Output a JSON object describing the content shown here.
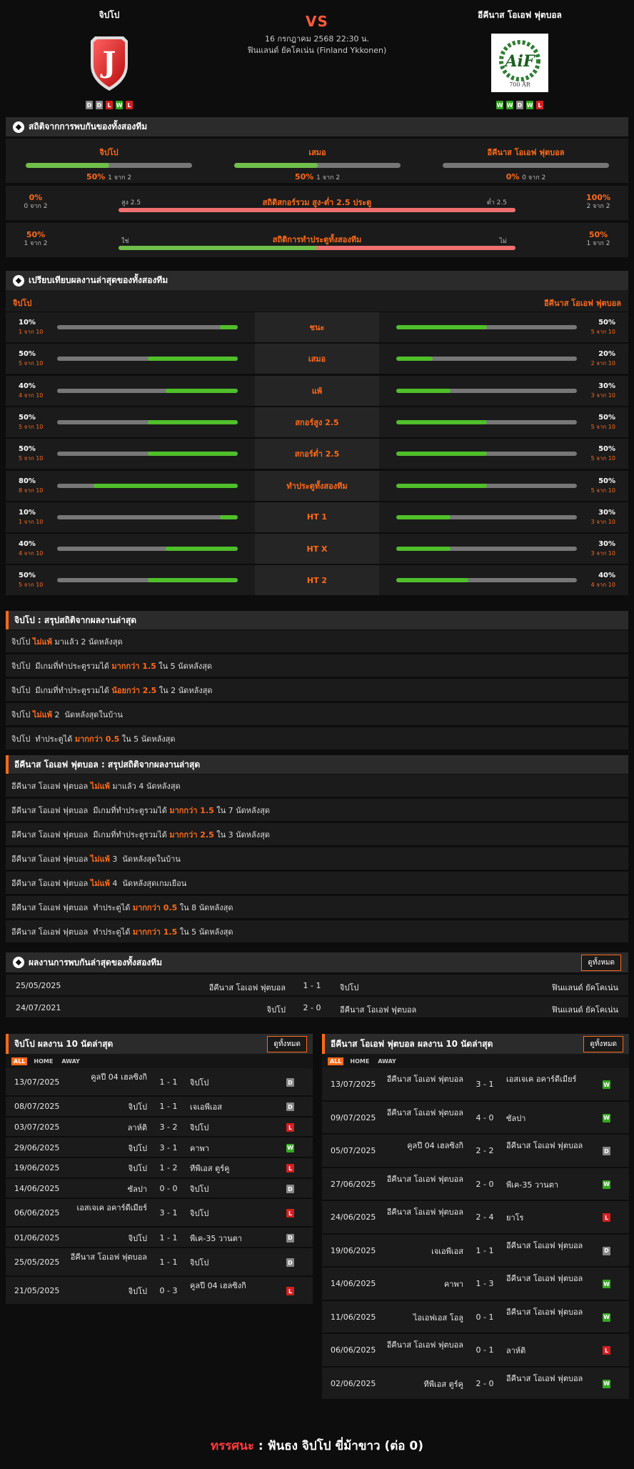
{
  "header": {
    "home": "จิปโป",
    "away": "อีคีนาส โอเอฟ ฟุตบอล",
    "vs": "VS",
    "datetime": "16 กรกฎาคม 2568 22:30 น.",
    "league": "ฟินแลนด์ ยัคโคเน่น (Finland Ykkonen)",
    "home_logo_letter": "J",
    "away_logo_text": "700 ÅR",
    "home_form": [
      "D",
      "D",
      "L",
      "W",
      "L"
    ],
    "away_form": [
      "W",
      "W",
      "D",
      "W",
      "L"
    ]
  },
  "h2h_stats": {
    "title": "สถิติจากการพบกันของทั้งสองทีม",
    "home": {
      "label": "จิปโป",
      "pct": "50%",
      "sub": "1 จาก 2",
      "value": 0.5
    },
    "draw": {
      "label": "เสมอ",
      "pct": "50%",
      "sub": "1 จาก 2",
      "value": 0.5
    },
    "away": {
      "label": "อีคีนาส โอเอฟ ฟุตบอล",
      "pct": "0%",
      "sub": "0 จาก 2",
      "value": 0
    },
    "ou": {
      "title": "สถิติสกอร์รวม สูง-ต่ำ 2.5 ประตู",
      "left_label": "สูง 2.5",
      "right_label": "ต่ำ 2.5",
      "left_pct": "0%",
      "left_sub": "0 จาก 2",
      "right_pct": "100%",
      "right_sub": "2 จาก 2",
      "value": 0
    },
    "btts": {
      "title": "สถิติการทำประตูทั้งสองทีม",
      "left_label": "ใช่",
      "right_label": "ไม่",
      "left_pct": "50%",
      "left_sub": "1 จาก 2",
      "right_pct": "50%",
      "right_sub": "1 จาก 2",
      "value": 0.5
    }
  },
  "compare": {
    "title": "เปรียบเทียบผลงานล่าสุดของทั้งสองทีม",
    "home": "จิปโป",
    "away": "อีคีนาส โอเอฟ ฟุตบอล",
    "rows": [
      {
        "label": "ชนะ",
        "hp": "10%",
        "hs": "1 จาก 10",
        "hv": 0.1,
        "ap": "50%",
        "as": "5 จาก 10",
        "av": 0.5
      },
      {
        "label": "เสมอ",
        "hp": "50%",
        "hs": "5 จาก 10",
        "hv": 0.5,
        "ap": "20%",
        "as": "2 จาก 10",
        "av": 0.2
      },
      {
        "label": "แพ้",
        "hp": "40%",
        "hs": "4 จาก 10",
        "hv": 0.4,
        "ap": "30%",
        "as": "3 จาก 10",
        "av": 0.3
      },
      {
        "label": "สกอร์สูง 2.5",
        "hp": "50%",
        "hs": "5 จาก 10",
        "hv": 0.5,
        "ap": "50%",
        "as": "5 จาก 10",
        "av": 0.5
      },
      {
        "label": "สกอร์ต่ำ 2.5",
        "hp": "50%",
        "hs": "5 จาก 10",
        "hv": 0.5,
        "ap": "50%",
        "as": "5 จาก 10",
        "av": 0.5
      },
      {
        "label": "ทำประตูทั้งสองทีม",
        "hp": "80%",
        "hs": "8 จาก 10",
        "hv": 0.8,
        "ap": "50%",
        "as": "5 จาก 10",
        "av": 0.5
      },
      {
        "label": "HT 1",
        "hp": "10%",
        "hs": "1 จาก 10",
        "hv": 0.1,
        "ap": "30%",
        "as": "3 จาก 10",
        "av": 0.3
      },
      {
        "label": "HT X",
        "hp": "40%",
        "hs": "4 จาก 10",
        "hv": 0.4,
        "ap": "30%",
        "as": "3 จาก 10",
        "av": 0.3
      },
      {
        "label": "HT 2",
        "hp": "50%",
        "hs": "5 จาก 10",
        "hv": 0.5,
        "ap": "40%",
        "as": "4 จาก 10",
        "av": 0.4
      }
    ]
  },
  "home_summary": {
    "title": "จิปโป : สรุปสถิติจากผลงานล่าสุด",
    "rows": [
      [
        "จิปโป ",
        "ไม่แพ้",
        " มาแล้ว 2 นัดหลังสุด"
      ],
      [
        "จิปโป  มีเกมที่ทำประตูรวมได้ ",
        "มากกว่า 1.5",
        " ใน 5 นัดหลังสุด"
      ],
      [
        "จิปโป  มีเกมที่ทำประตูรวมได้ ",
        "น้อยกว่า 2.5",
        " ใน 2 นัดหลังสุด"
      ],
      [
        "จิปโป ",
        "ไม่แพ้",
        " 2  นัดหลังสุดในบ้าน"
      ],
      [
        "จิปโป  ทำประตูได้ ",
        "มากกว่า 0.5",
        " ใน 5 นัดหลังสุด"
      ]
    ]
  },
  "away_summary": {
    "title": "อีคีนาส โอเอฟ ฟุตบอล : สรุปสถิติจากผลงานล่าสุด",
    "rows": [
      [
        "อีคีนาส โอเอฟ ฟุตบอล ",
        "ไม่แพ้",
        " มาแล้ว 4 นัดหลังสุด"
      ],
      [
        "อีคีนาส โอเอฟ ฟุตบอล  มีเกมที่ทำประตูรวมได้ ",
        "มากกว่า 1.5",
        " ใน 7 นัดหลังสุด"
      ],
      [
        "อีคีนาส โอเอฟ ฟุตบอล  มีเกมที่ทำประตูรวมได้ ",
        "มากกว่า 2.5",
        " ใน 3 นัดหลังสุด"
      ],
      [
        "อีคีนาส โอเอฟ ฟุตบอล ",
        "ไม่แพ้",
        " 3  นัดหลังสุดในบ้าน"
      ],
      [
        "อีคีนาส โอเอฟ ฟุตบอล ",
        "ไม่แพ้",
        " 4  นัดหลังสุดเกมเยือน"
      ],
      [
        "อีคีนาส โอเอฟ ฟุตบอล  ทำประตูได้ ",
        "มากกว่า 0.5",
        " ใน 8 นัดหลังสุด"
      ],
      [
        "อีคีนาส โอเอฟ ฟุตบอล  ทำประตูได้ ",
        "มากกว่า 1.5",
        " ใน 5 นัดหลังสุด"
      ]
    ]
  },
  "h2h_results": {
    "title": "ผลงานการพบกันล่าสุดของทั้งสองทีม",
    "view_all": "ดูทั้งหมด",
    "rows": [
      {
        "date": "25/05/2025",
        "home": "อีคีนาส โอเอฟ ฟุตบอล",
        "score": "1 - 1",
        "away": "จิปโป",
        "league": "ฟินแลนด์ ยัคโคเน่น"
      },
      {
        "date": "24/07/2021",
        "home": "จิปโป",
        "score": "2 - 0",
        "away": "อีคีนาส โอเอฟ ฟุตบอล",
        "league": "ฟินแลนด์ ยัคโคเน่น"
      }
    ]
  },
  "tabs": [
    "ALL",
    "HOME",
    "AWAY"
  ],
  "home_last": {
    "title": "จิปโป ผลงาน 10 นัดล่าสุด",
    "view_all": "ดูทั้งหมด",
    "rows": [
      {
        "date": "13/07/2025",
        "home": "คูลปี 04 เฮลซิงกิ",
        "score": "1 - 1",
        "away": "จิปโป",
        "r": "D"
      },
      {
        "date": "08/07/2025",
        "home": "จิปโป",
        "score": "1 - 1",
        "away": "เจเอพีเอส",
        "r": "D"
      },
      {
        "date": "03/07/2025",
        "home": "ลาห์ติ",
        "score": "3 - 2",
        "away": "จิปโป",
        "r": "L"
      },
      {
        "date": "29/06/2025",
        "home": "จิปโป",
        "score": "3 - 1",
        "away": "คาพา",
        "r": "W"
      },
      {
        "date": "19/06/2025",
        "home": "จิปโป",
        "score": "1 - 2",
        "away": "ทีพีเอส ตูร์คู",
        "r": "L"
      },
      {
        "date": "14/06/2025",
        "home": "ซัลปา",
        "score": "0 - 0",
        "away": "จิปโป",
        "r": "D"
      },
      {
        "date": "06/06/2025",
        "home": "เอสเจเค อคาร์ดีเมียร์",
        "score": "3 - 1",
        "away": "จิปโป",
        "r": "L"
      },
      {
        "date": "01/06/2025",
        "home": "จิปโป",
        "score": "1 - 1",
        "away": "พีเค-35 วานตา",
        "r": "D"
      },
      {
        "date": "25/05/2025",
        "home": "อีคีนาส โอเอฟ ฟุตบอล",
        "score": "1 - 1",
        "away": "จิปโป",
        "r": "D"
      },
      {
        "date": "21/05/2025",
        "home": "จิปโป",
        "score": "0 - 3",
        "away": "คูลปี 04 เฮลซิงกิ",
        "r": "L"
      }
    ]
  },
  "away_last": {
    "title": "อีคีนาส โอเอฟ ฟุตบอล ผลงาน 10 นัดล่าสุด",
    "view_all": "ดูทั้งหมด",
    "rows": [
      {
        "date": "13/07/2025",
        "home": "อีคีนาส โอเอฟ ฟุตบอล",
        "score": "3 - 1",
        "away": "เอสเจเค อคาร์ดีเมียร์",
        "r": "W"
      },
      {
        "date": "09/07/2025",
        "home": "อีคีนาส โอเอฟ ฟุตบอล",
        "score": "4 - 0",
        "away": "ซัลปา",
        "r": "W"
      },
      {
        "date": "05/07/2025",
        "home": "คูลปี 04 เฮลซิงกิ",
        "score": "2 - 2",
        "away": "อีคีนาส โอเอฟ ฟุตบอล",
        "r": "D"
      },
      {
        "date": "27/06/2025",
        "home": "อีคีนาส โอเอฟ ฟุตบอล",
        "score": "2 - 0",
        "away": "พีเค-35 วานตา",
        "r": "W"
      },
      {
        "date": "24/06/2025",
        "home": "อีคีนาส โอเอฟ ฟุตบอล",
        "score": "2 - 4",
        "away": "ยาโร",
        "r": "L"
      },
      {
        "date": "19/06/2025",
        "home": "เจเอพีเอส",
        "score": "1 - 1",
        "away": "อีคีนาส โอเอฟ ฟุตบอล",
        "r": "D"
      },
      {
        "date": "14/06/2025",
        "home": "คาพา",
        "score": "1 - 3",
        "away": "อีคีนาส โอเอฟ ฟุตบอล",
        "r": "W"
      },
      {
        "date": "11/06/2025",
        "home": "ไอเอฟเอส โอลู",
        "score": "0 - 1",
        "away": "อีคีนาส โอเอฟ ฟุตบอล",
        "r": "W"
      },
      {
        "date": "06/06/2025",
        "home": "อีคีนาส โอเอฟ ฟุตบอล",
        "score": "0 - 1",
        "away": "ลาห์ติ",
        "r": "L"
      },
      {
        "date": "02/06/2025",
        "home": "ทีพีเอส ตูร์คู",
        "score": "2 - 0",
        "away": "อีคีนาส โอเอฟ ฟุตบอล",
        "r": "W"
      }
    ]
  },
  "footer": {
    "label": "ทรรศนะ",
    "sep": " : ",
    "text": "ฟันธง จิปโป ขี่ม้าขาว (ต่อ 0)"
  }
}
